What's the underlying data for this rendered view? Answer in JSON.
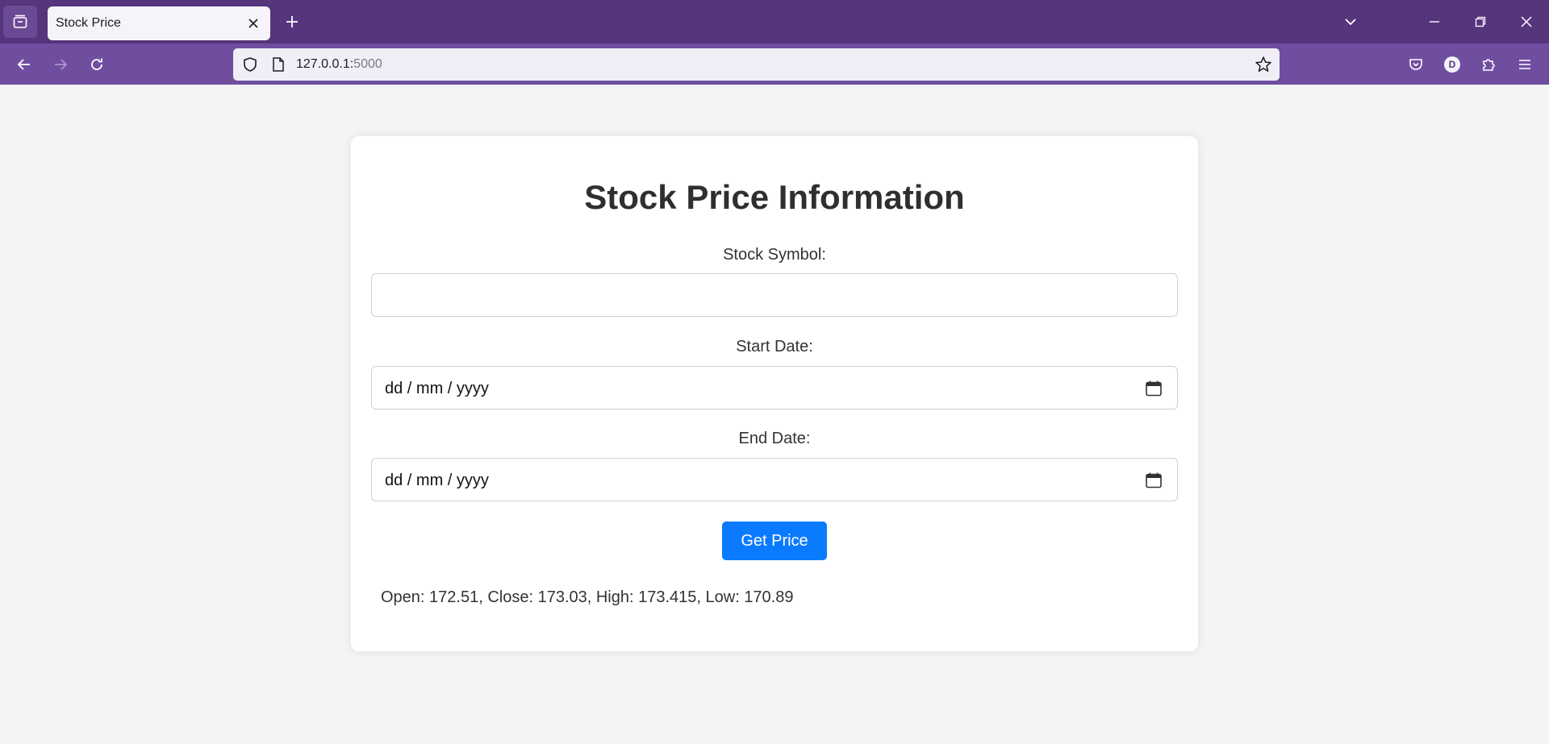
{
  "browser": {
    "tab": {
      "title": "Stock Price",
      "close_icon": "close-icon"
    },
    "url": {
      "host": "127.0.0.1:",
      "port": "5000"
    },
    "profile_initial": "D",
    "colors": {
      "tabbar": "#55357c",
      "navbar": "#6f4ea0"
    }
  },
  "page": {
    "title": "Stock Price Information",
    "symbol_label": "Stock Symbol:",
    "symbol_value": "",
    "start_label": "Start Date:",
    "start_placeholder": "dd / mm / yyyy",
    "end_label": "End Date:",
    "end_placeholder": "dd / mm / yyyy",
    "button_label": "Get Price",
    "result": "Open: 172.51, Close: 173.03, High: 173.415, Low: 170.89",
    "colors": {
      "button": "#0a7bff",
      "background": "#f4f4f4",
      "card": "#ffffff"
    }
  }
}
